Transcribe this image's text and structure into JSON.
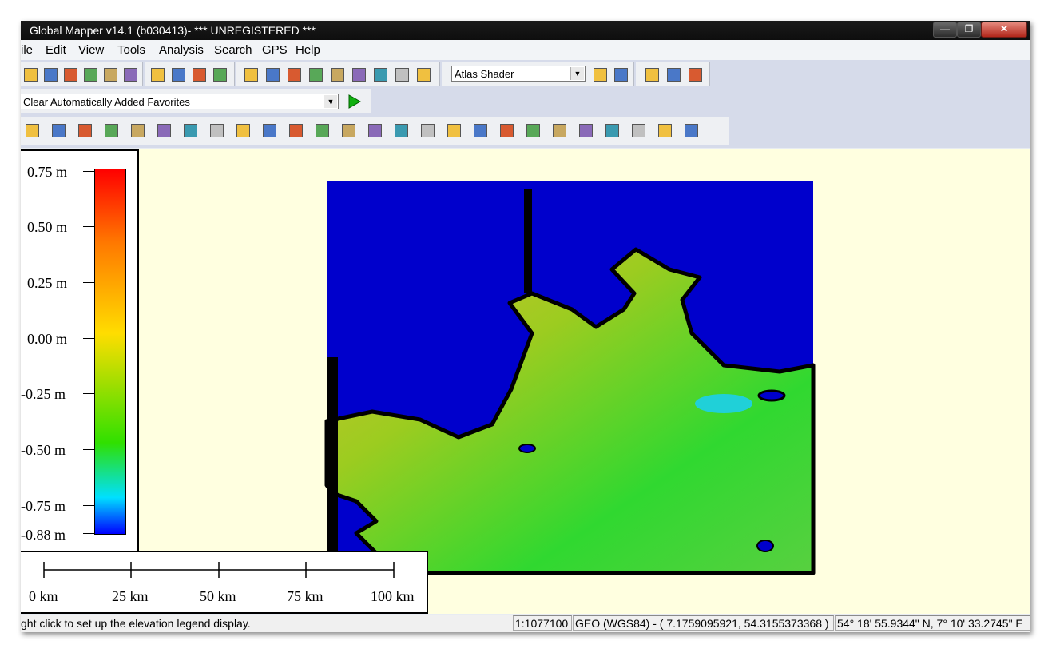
{
  "window": {
    "title": "Global Mapper v14.1 (b030413)- *** UNREGISTERED ***",
    "controls": {
      "minimize": "—",
      "maximize": "❐",
      "close": "✕"
    }
  },
  "menu": [
    "ile",
    "Edit",
    "View",
    "Tools",
    "Analysis",
    "Search",
    "GPS",
    "Help"
  ],
  "toolbar1": {
    "file_icons": [
      "open-folder-icon",
      "save-icon",
      "globe-icon",
      "catalog-icon",
      "layers-icon",
      "config-icon"
    ],
    "zoom_icons": [
      "zoom-in-icon",
      "zoom-out-icon",
      "zoom-box-icon",
      "home-icon"
    ],
    "tool_icons": [
      "select-tool-icon",
      "pan-tool-icon",
      "measure-tool-icon",
      "info-tool-icon",
      "3d-path-icon",
      "tower-tool-icon",
      "draw-tool-icon",
      "dropdown-icon",
      "shield-icon"
    ],
    "shader": "Atlas Shader",
    "shader_icons": [
      "shader-config-icon",
      "3d-view-icon"
    ],
    "extra_icons": [
      "flag-icon",
      "document-icon",
      "sparkle-icon"
    ]
  },
  "toolbar2": {
    "favorites": "Clear Automatically Added Favorites",
    "run_icon": "play-icon"
  },
  "toolbar3": {
    "icons": [
      "layer-edit-icon",
      "layer-add-icon",
      "contour-icon",
      "shape-icon",
      "area-add-icon",
      "code-area-icon",
      "blend-icon",
      "grid-icon",
      "point-icon",
      "line-edit-icon",
      "digitize-icon",
      "terrain-icon",
      "terrain-cut-icon",
      "path-edit-icon",
      "path-split-icon",
      "area-merge-icon",
      "area-split-icon",
      "area-rotate-icon",
      "area-crop-icon",
      "area-copy-icon",
      "fill-icon",
      "fill-add-icon",
      "fill-remove-icon",
      "undo-icon",
      "redo-up-icon",
      "redo-icon"
    ]
  },
  "legend": {
    "labels": [
      "0.75 m",
      "0.50 m",
      "0.25 m",
      "0.00 m",
      "-0.25 m",
      "-0.50 m",
      "-0.75 m",
      "-0.88 m"
    ],
    "colors": [
      "#ff0000",
      "#ff7800",
      "#ffdd00",
      "#30e000",
      "#00e0ff",
      "#0000ff"
    ]
  },
  "scale": {
    "labels": [
      "0 km",
      "25 km",
      "50 km",
      "75 km",
      "100 km"
    ]
  },
  "map": {
    "water_color": "#0000cc",
    "background": "#ffffe0"
  },
  "status": {
    "hint": "ght click to set up the elevation legend display.",
    "scale": "1:1077100",
    "projection": "GEO (WGS84) - ( 7.1759095921, 54.3155373368 )",
    "coords": "54° 18' 55.9344\" N, 7° 10' 33.2745\" E"
  }
}
